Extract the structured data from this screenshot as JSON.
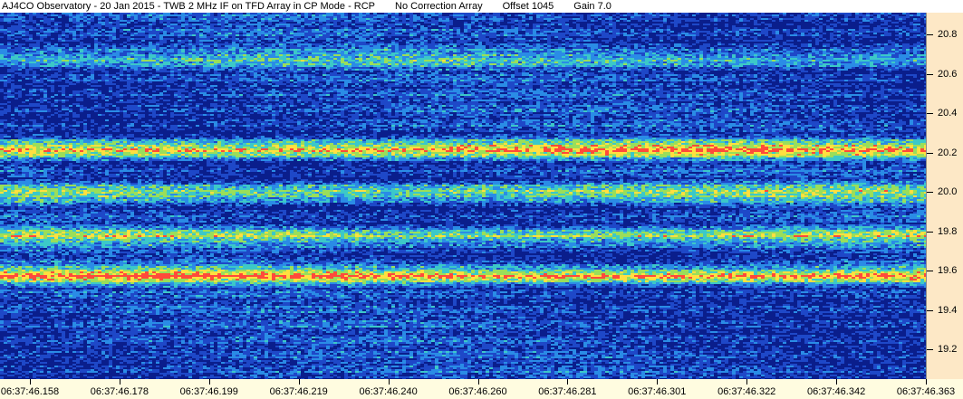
{
  "header": {
    "observatory": "AJ4CO Observatory - 20 Jan 2015 - TWB 2 MHz IF on TFD Array in CP Mode - RCP",
    "array": "No Correction Array",
    "offset": "Offset 1045",
    "gain": "Gain 7.0"
  },
  "chart_data": {
    "type": "heatmap",
    "title": "",
    "xlabel": "",
    "ylabel": "",
    "x_ticks": [
      "06:37:46.158",
      "06:37:46.178",
      "06:37:46.199",
      "06:37:46.219",
      "06:37:46.240",
      "06:37:46.260",
      "06:37:46.281",
      "06:37:46.301",
      "06:37:46.322",
      "06:37:46.342",
      "06:37:46.363"
    ],
    "y_ticks": [
      20.8,
      20.6,
      20.4,
      20.2,
      20.0,
      19.8,
      19.6,
      19.4,
      19.2
    ],
    "y_ticks_labels": [
      "20.8",
      "20.6",
      "20.4",
      "20.2",
      "20.0",
      "19.8",
      "19.6",
      "19.4",
      "19.2"
    ],
    "ylim": [
      19.05,
      20.91
    ],
    "colormap": [
      "#0a1e8c",
      "#1e48c8",
      "#2a8ce6",
      "#3cc8c8",
      "#9ade5a",
      "#ffe040",
      "#ff4a3a"
    ],
    "description_bands": [
      {
        "freq": 19.58,
        "intensity": "high"
      },
      {
        "freq": 19.78,
        "intensity": "medium"
      },
      {
        "freq": 20.22,
        "intensity": "high"
      },
      {
        "freq": 20.0,
        "intensity": "medium"
      },
      {
        "freq": 20.68,
        "intensity": "low"
      }
    ]
  }
}
